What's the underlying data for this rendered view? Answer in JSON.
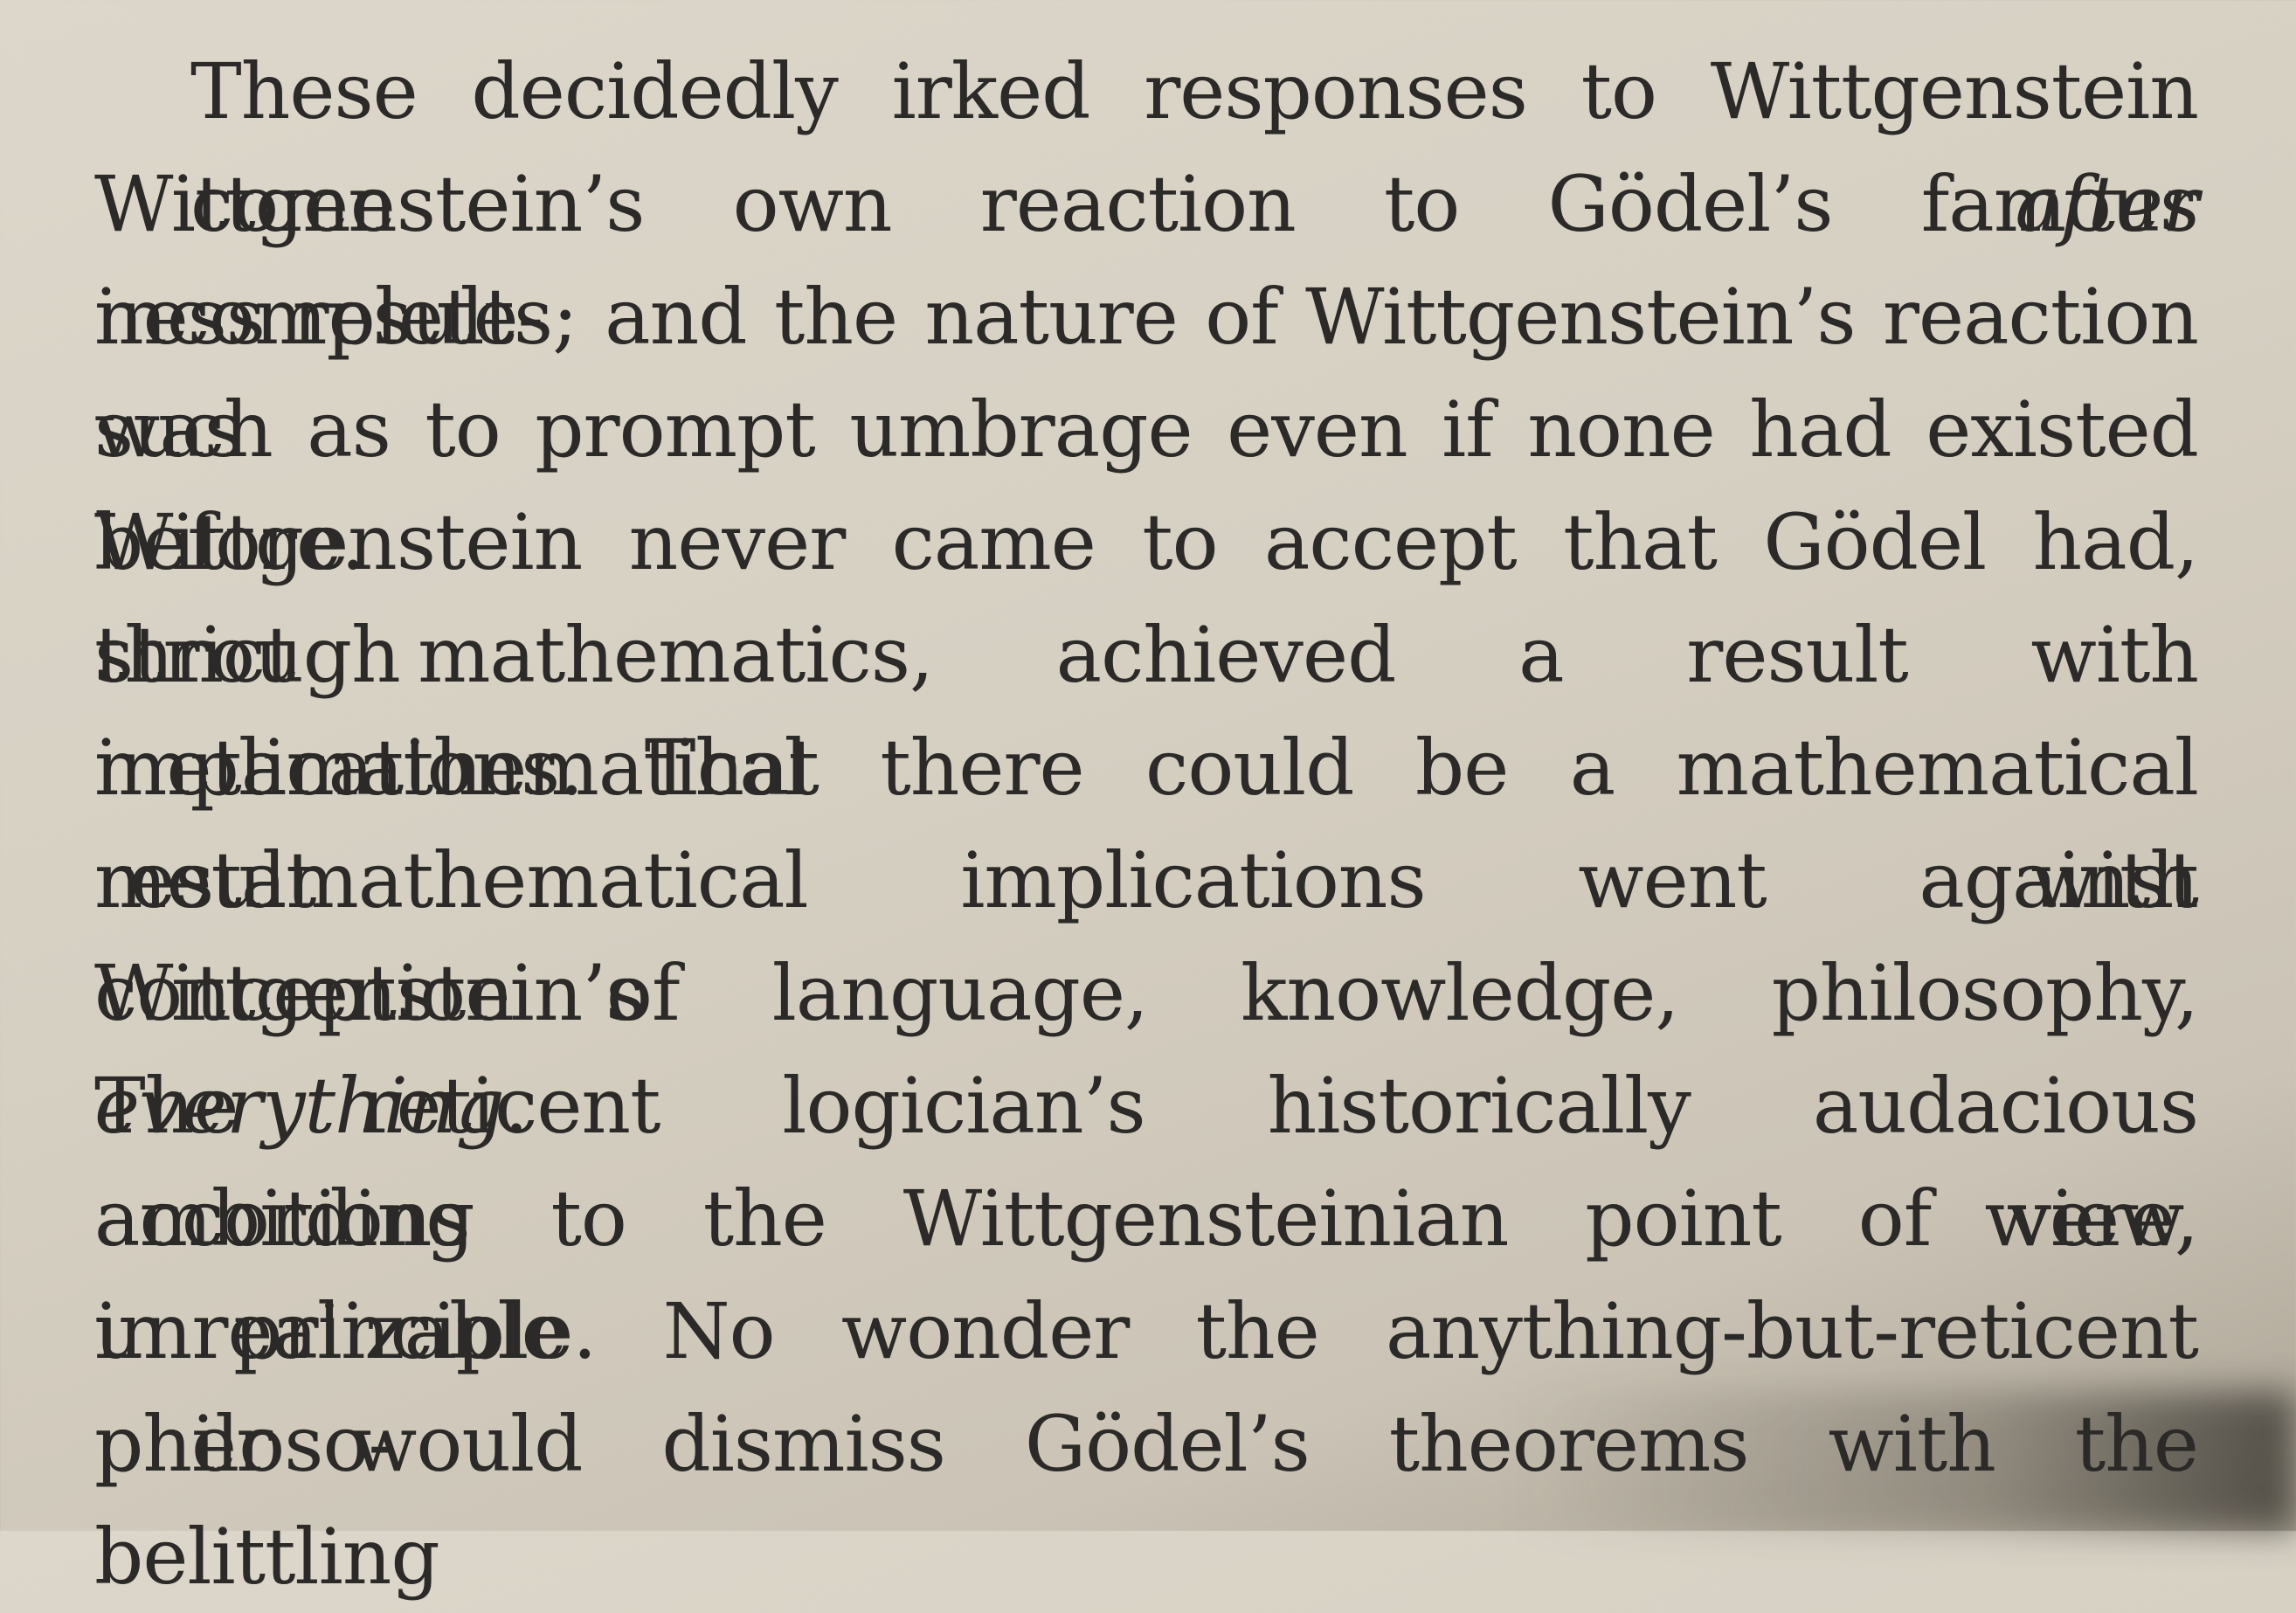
{
  "lines": [
    {
      "a": "These decidedly irked responses to Wittgenstein come ",
      "i": "after",
      "b": ""
    },
    {
      "a": "Wittgenstein’s own reaction to Gödel’s famous incomplete-",
      "i": "",
      "b": ""
    },
    {
      "a": "ness results; and the nature of Wittgenstein’s reaction was",
      "i": "",
      "b": ""
    },
    {
      "a": "such as to prompt umbrage even if none had existed before.",
      "i": "",
      "b": ""
    },
    {
      "a": "Wittgenstein never came to accept that Gödel had, through",
      "i": "",
      "b": ""
    },
    {
      "a": "strict mathematics, achieved a result with metamathematical",
      "i": "",
      "b": ""
    },
    {
      "a": "implications. That there could be a mathematical result with",
      "i": "",
      "b": ""
    },
    {
      "a": "metamathematical implications went against Wittgenstein’s",
      "i": "",
      "b": ""
    },
    {
      "a": "conception of language, knowledge, philosophy, ",
      "i": "everything",
      "b": "."
    },
    {
      "a": "The reticent logician’s historically audacious ambitions were,",
      "i": "",
      "b": ""
    },
    {
      "a": "according to the Wittgensteinian point of view, unrealizable",
      "i": "",
      "b": ""
    },
    {
      "a": "in principle. No wonder the anything-but-reticent philoso-",
      "i": "",
      "b": ""
    },
    {
      "a": "pher would dismiss Gödel’s theorems with the belittling",
      "i": "",
      "b": ""
    }
  ]
}
